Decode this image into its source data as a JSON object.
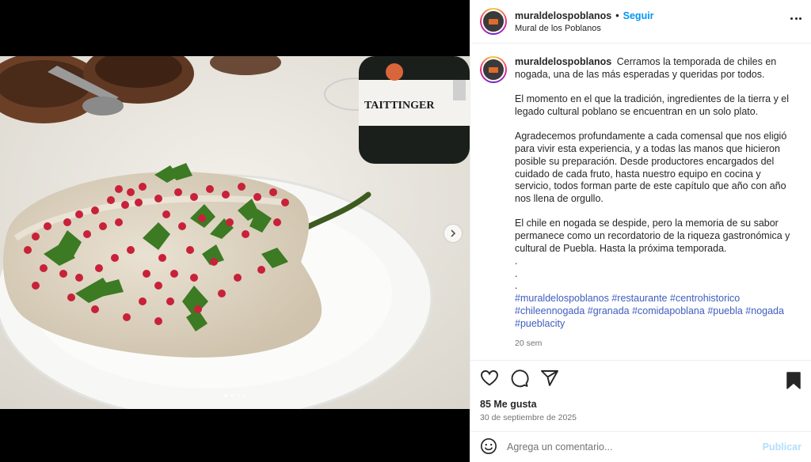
{
  "header": {
    "username": "muraldelospoblanos",
    "separator": "•",
    "follow_label": "Seguir",
    "location": "Mural de los Poblanos"
  },
  "caption": {
    "username": "muraldelospoblanos",
    "intro": "Cerramos la temporada de chiles en nogada, una de las más esperadas y queridas por todos.",
    "paragraphs": [
      "El momento en el que la tradición, ingredientes de la tierra y el legado cultural poblano se encuentran en un solo plato.",
      "Agradecemos profundamente a cada comensal que nos eligió para vivir esta experiencia, y a todas las manos que hicieron posible su preparación. Desde productores encargados del cuidado de cada fruto, hasta nuestro equipo en cocina y servicio, todos forman parte de este capítulo que año con año nos llena de orgullo.",
      "El chile en nogada se despide, pero la memoria de su sabor permanece como un recordatorio de la riqueza gastronómica y cultural de Puebla. Hasta la próxima temporada."
    ],
    "dots": [
      ".",
      ".",
      "."
    ],
    "hashtags": [
      "#muraldelospoblanos",
      "#restaurante",
      "#centrohistorico",
      "#chileennogada",
      "#granada",
      "#comidapoblana",
      "#puebla",
      "#nogada",
      "#pueblacity"
    ],
    "time_ago": "20 sem"
  },
  "media": {
    "bottle_label": "TAITTINGER",
    "slide_count": 4,
    "active_slide": 1
  },
  "actions": {
    "likes": "85 Me gusta",
    "date": "30 de septiembre de 2025"
  },
  "comment": {
    "placeholder": "Agrega un comentario...",
    "publish_label": "Publicar"
  },
  "icons": [
    "more-options-icon",
    "heart-icon",
    "comment-icon",
    "share-icon",
    "bookmark-icon",
    "emoji-icon",
    "chevron-right-icon"
  ],
  "colors": {
    "link": "#0095f6",
    "hashtag": "#3f5dbf",
    "muted": "#737373",
    "publish": "#b2dffc"
  }
}
